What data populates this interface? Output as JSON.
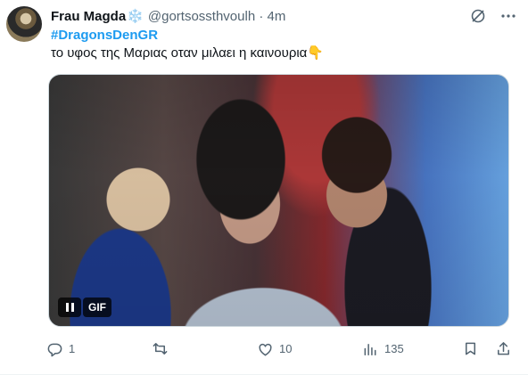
{
  "author": {
    "name": "Frau Magda",
    "badge_emoji": "❄️",
    "handle": "@gortsossthvoulh",
    "separator": "·",
    "time": "4m"
  },
  "hashtag": "#DragonsDenGR",
  "body_text": "το υφος της Μαριας οταν μιλαει η καινουρια👇",
  "media": {
    "type": "gif",
    "badge_label": "GIF"
  },
  "actions": {
    "reply_count": "1",
    "retweet_count": "",
    "like_count": "10",
    "views_count": "135"
  },
  "icons": [
    "grok-icon",
    "more-icon",
    "pause-icon",
    "reply-icon",
    "retweet-icon",
    "like-icon",
    "views-icon",
    "share-icon"
  ],
  "colors": {
    "accent": "#1d9bf0",
    "muted": "#536471",
    "text": "#0f1419"
  }
}
